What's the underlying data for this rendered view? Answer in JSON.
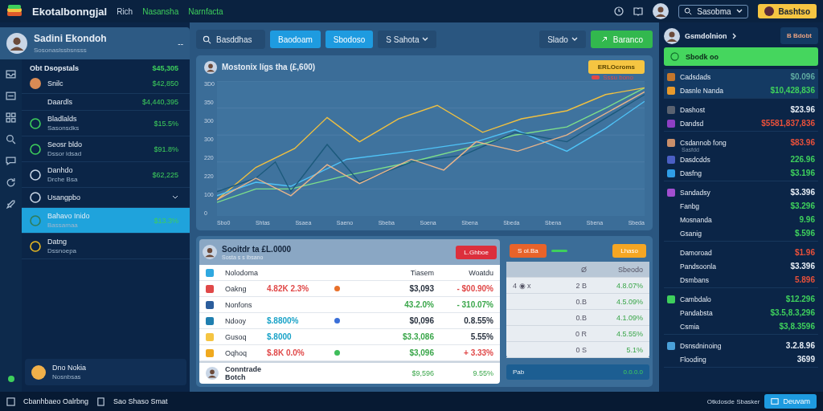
{
  "topbar": {
    "brand": "Ekotalbonngjal",
    "links": [
      {
        "label": "Rich",
        "selected": false
      },
      {
        "label": "Nasansha",
        "selected": true
      },
      {
        "label": "Narnfacta",
        "selected": true
      }
    ],
    "account": "Sasobma",
    "action": "Bashtso"
  },
  "profile": {
    "name": "Sadini Ekondoh",
    "subtitle": "Sosonaslssbsnsss",
    "more": "--"
  },
  "accounts_header": {
    "title": "Obt Dsopstals",
    "value": "$45,305"
  },
  "accounts": [
    {
      "kind": "coin",
      "title": "Snilc",
      "value": "$42,850",
      "selected": false,
      "color": "#d98b55"
    },
    {
      "kind": "plain",
      "title": "Daardls",
      "value": "$4,440,395",
      "selected": false
    },
    {
      "kind": "ring",
      "title": "Bladlalds",
      "subtitle": "Sasonsdks",
      "value": "$15.5%",
      "selected": false,
      "color": "#3ecf5c"
    },
    {
      "kind": "ring",
      "title": "Seosr bldo",
      "subtitle": "Dssor idsad",
      "value": "$91.8%",
      "selected": false,
      "color": "#3ecf5c"
    },
    {
      "kind": "ring",
      "title": "Danhdo",
      "subtitle": "Drche Bsa",
      "value": "$62,225",
      "selected": false,
      "color": "#c9d6e6"
    },
    {
      "kind": "expander",
      "title": "Usangpbo",
      "selected": false,
      "color": "#c9d6e6"
    },
    {
      "kind": "ring",
      "title": "Bahavo Inido",
      "subtitle": "Bassamaa",
      "value": "$13.3%",
      "selected": true,
      "color": "#2f7d5a"
    },
    {
      "kind": "ring",
      "title": "Datng",
      "subtitle": "Dssnoepa",
      "selected": false,
      "color": "#e8b923"
    }
  ],
  "wallet_card": {
    "title": "Dno Nokia",
    "subtitle": "Nosnbsas"
  },
  "toolbar": {
    "search": "Basddhas",
    "buttons": [
      "Baodoam",
      "Sbodoso"
    ],
    "filter": "S Sahota",
    "sort": "Slado",
    "primary": "Baranco"
  },
  "chart_card": {
    "title": "Mostonix lígs tha (£,600)",
    "badge": "ERLOcroms",
    "legend": "Sssu bono",
    "y_labels": [
      "3D0",
      "350",
      "300",
      "300",
      "220",
      "220",
      "100",
      "0"
    ],
    "x_labels": [
      "Sbo0",
      "Shtas",
      "Ssaea",
      "Saeno",
      "Sbeba",
      "Soena",
      "Sbena",
      "Sbeda",
      "Sbena",
      "Sbena",
      "Sbeda"
    ]
  },
  "holdings": {
    "title": "Sooitdr ta £L.0000",
    "subtitle": "Sosta s s ibsano",
    "alert": "L.Ghboe",
    "sell": "S ol.Ba",
    "watch": "Lhaso",
    "columns": [
      "Nolodoma",
      "Tiasem",
      "Woatdu"
    ],
    "rows": [
      {
        "name": "Oakng",
        "color": "#e04848",
        "change": {
          "text": "4.82K 2.3%",
          "color": "#e04848"
        },
        "dot": {
          "color": "#e8702a"
        },
        "value": {
          "text": "$3,093",
          "color": "#2a3340"
        },
        "pct": {
          "text": "- $00.90%",
          "color": "#e04848"
        }
      },
      {
        "name": "Nonfons",
        "color": "#2b5d9c",
        "value": {
          "text": "43.2.0%",
          "color": "#3aa64a"
        },
        "pct": {
          "text": "- 310.07%",
          "color": "#3aa64a"
        }
      },
      {
        "name": "Ndooy",
        "color": "#1f7fb0",
        "change": {
          "text": "$.8800%",
          "color": "#1aa3c8"
        },
        "dot": {
          "color": "#3a6fd8"
        },
        "value": {
          "text": "$0,096",
          "color": "#2a3340"
        },
        "pct": {
          "text": "0.8.55%",
          "color": "#2a3340"
        }
      },
      {
        "name": "Gusoq",
        "color": "#f5c542",
        "change": {
          "text": "$.8000",
          "color": "#1aa3c8"
        },
        "value": {
          "text": "$3.3,086",
          "color": "#3aa64a"
        },
        "pct": {
          "text": "5.55%",
          "color": "#2a3340"
        }
      },
      {
        "name": "Oqhoq",
        "color": "#f0a91e",
        "change": {
          "text": "$.8K 0.0%",
          "color": "#e04848"
        },
        "dot": {
          "color": "#3ebd5a"
        },
        "value": {
          "text": "$3,096",
          "color": "#3aa64a"
        },
        "pct": {
          "text": "+ 3.33%",
          "color": "#e04848"
        }
      }
    ],
    "total": {
      "name": "Conntrade Botch",
      "value": "$9,596",
      "pct": "9.55%"
    },
    "side_columns": [
      "Ø",
      "Sbeodo"
    ],
    "side_rows": [
      {
        "label": "4 ◉ x",
        "qty": "2 B",
        "pct": "4.8.07%"
      },
      {
        "qty": "0.B",
        "pct": "4.5.09%"
      },
      {
        "qty": "0.B",
        "pct": "4.1.09%"
      },
      {
        "qty": "0 R",
        "pct": "4.5.55%"
      },
      {
        "qty": "0 S",
        "pct": "5.1%"
      }
    ],
    "side_total": {
      "label": "Pab",
      "value": "0.0.0.0"
    }
  },
  "right_panel": {
    "name": "Gsmdolnion",
    "action": "B Bdobt",
    "highlight": "Sbodk oo",
    "groups": [
      {
        "selected": true,
        "rows": [
          {
            "title": "Cadsdads",
            "value": {
              "text": "$0.096",
              "color": "#5fa9a0"
            },
            "color": "#c4762c"
          },
          {
            "title": "Dasnle Nanda",
            "value": {
              "text": "$10,428,836",
              "color": "#3ecf5c"
            },
            "color": "#e89a2c"
          }
        ]
      },
      {
        "selected": false,
        "rows": [
          {
            "title": "Dashost",
            "value": {
              "text": "$23.96",
              "color": "#e6edf5"
            },
            "color": "#5a6270"
          },
          {
            "title": "Dandsd",
            "value": {
              "text": "$5581,837,836",
              "color": "#e8503a"
            },
            "color": "#8e3fc4"
          }
        ]
      },
      {
        "selected": false,
        "rows": [
          {
            "title": "Csdannob fong",
            "subtitle": "Sasfdd",
            "value": {
              "text": "$83.96",
              "color": "#e8503a"
            },
            "color": "#c98f6a"
          },
          {
            "title": "Dasdcdds",
            "value": {
              "text": "226.96",
              "color": "#3ecf5c"
            },
            "color": "#4b5fc4"
          },
          {
            "title": "Dasfng",
            "value": {
              "text": "$3.196",
              "color": "#3ecf5c"
            },
            "color": "#2f9ee8"
          }
        ]
      },
      {
        "selected": false,
        "rows": [
          {
            "title": "Sandadsy",
            "value": {
              "text": "$3.396",
              "color": "#e6edf5"
            },
            "color": "#a24fd0"
          },
          {
            "title": "Fanbg",
            "value": {
              "text": "$3.296",
              "color": "#3ecf5c"
            }
          },
          {
            "title": "Mosnanda",
            "value": {
              "text": "9.96",
              "color": "#3ecf5c"
            }
          },
          {
            "title": "Gsanig",
            "value": {
              "text": "$.596",
              "color": "#3ecf5c"
            }
          }
        ]
      },
      {
        "selected": false,
        "rows": [
          {
            "title": "Damoroad",
            "value": {
              "text": "$1.96",
              "color": "#e8503a"
            }
          },
          {
            "title": "Pandsoonla",
            "value": {
              "text": "$3.396",
              "color": "#e6edf5"
            }
          },
          {
            "title": "Dsmbans",
            "value": {
              "text": "5.896",
              "color": "#e8503a"
            }
          }
        ]
      },
      {
        "selected": false,
        "rows": [
          {
            "title": "Cambdalo",
            "value": {
              "text": "$12.296",
              "color": "#3ecf5c"
            },
            "color": "#3ecf5c"
          },
          {
            "title": "Pandabsta",
            "value": {
              "text": "$3.5,8.3,296",
              "color": "#3ecf5c"
            }
          },
          {
            "title": "Csmia",
            "value": {
              "text": "$3,8.3596",
              "color": "#3ecf5c"
            }
          }
        ]
      },
      {
        "selected": false,
        "rows": [
          {
            "title": "Dsnsdninoing",
            "value": {
              "text": "3.2.8.96",
              "color": "#e6edf5"
            },
            "color": "#4aa0d8"
          },
          {
            "title": "Flooding",
            "value": {
              "text": "3699",
              "color": "#e6edf5"
            }
          }
        ]
      }
    ],
    "footer": "Otkdosde Sbasker",
    "footer_button": "Deuvam"
  },
  "status_bar": [
    "Cbanhbaeo Oalrbng",
    "Sao Shaso Smat"
  ]
}
